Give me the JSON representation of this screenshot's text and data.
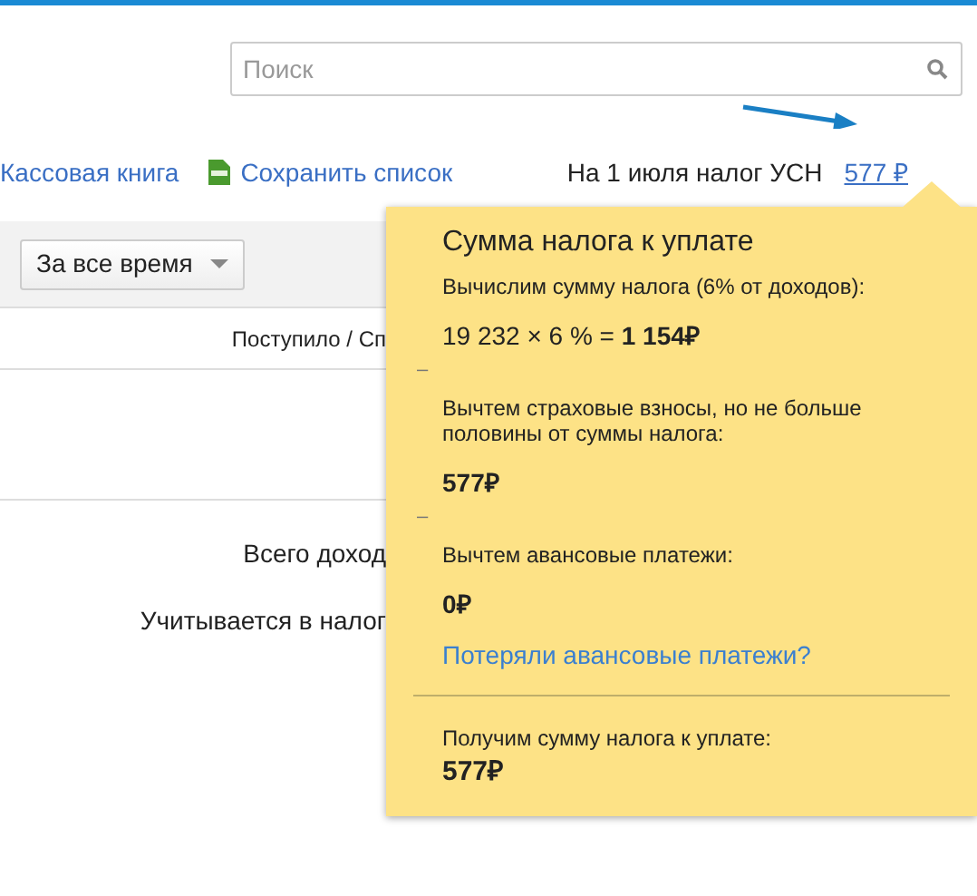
{
  "search": {
    "placeholder": "Поиск"
  },
  "links": [
    {
      "kind": "plain",
      "label": "Кассовая книга"
    },
    {
      "kind": "xls",
      "label": "Сохранить список"
    }
  ],
  "tax_notice": {
    "label": "На 1 июля налог УСН",
    "amount": "577 ₽"
  },
  "period_dropdown": {
    "value": "За все время"
  },
  "table": {
    "column_header": "Поступило / Сп"
  },
  "summary": [
    "Всего доход",
    "Учитывается в налог"
  ],
  "popup": {
    "title": "Сумма налога к уплате",
    "lines": [
      {
        "kind": "label",
        "text": "Вычислим сумму налога (6% от доходов):"
      },
      {
        "kind": "formula",
        "text": "19 232 × 6 % = **1 154₽**"
      },
      {
        "kind": "dash",
        "text": "–"
      },
      {
        "kind": "label",
        "text": "Вычтем страховые взносы, но не больше половины от суммы налога:"
      },
      {
        "kind": "amount",
        "text": "577₽"
      },
      {
        "kind": "dash",
        "text": "–"
      },
      {
        "kind": "label",
        "text": "Вычтем авансовые платежи:"
      },
      {
        "kind": "amount",
        "text": "0₽"
      },
      {
        "kind": "link",
        "text": "Потеряли авансовые платежи?"
      }
    ],
    "total": {
      "label": "Получим сумму налога к уплате:",
      "amount": "577₽"
    }
  }
}
